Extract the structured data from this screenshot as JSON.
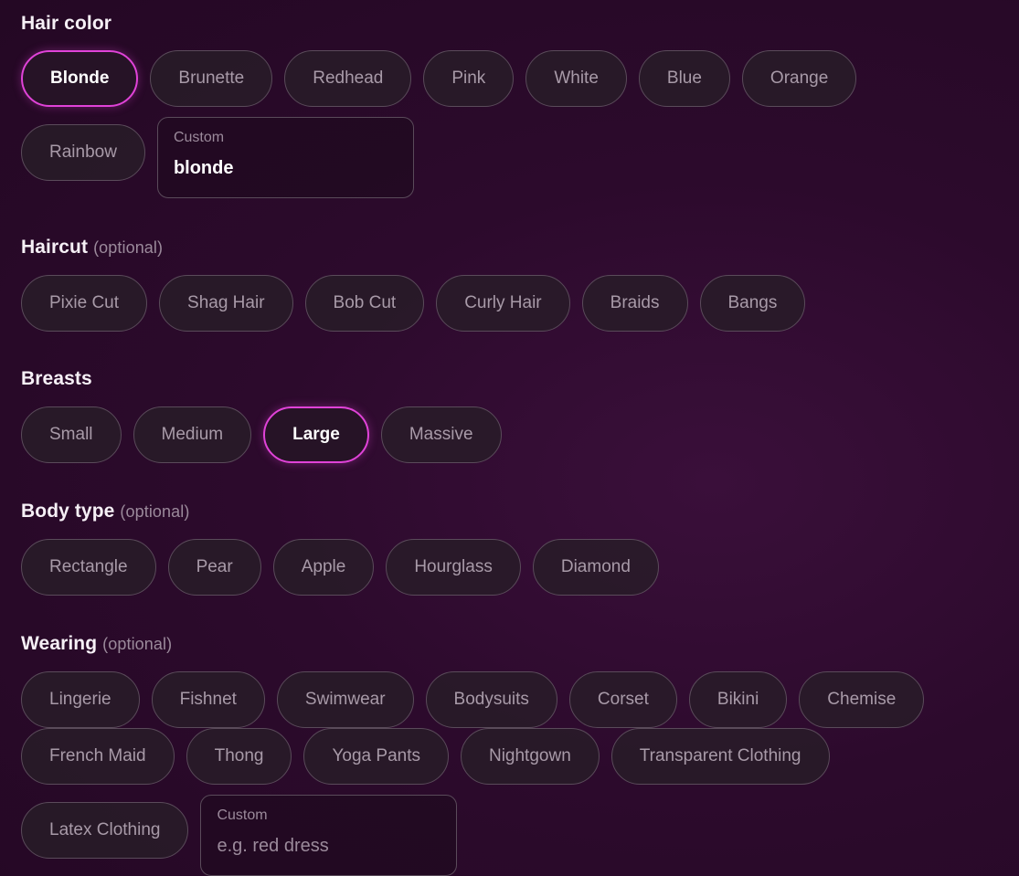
{
  "hair_color": {
    "title": "Hair color",
    "options": [
      "Blonde",
      "Brunette",
      "Redhead",
      "Pink",
      "White",
      "Blue",
      "Orange",
      "Rainbow"
    ],
    "selected": "Blonde",
    "custom_label": "Custom",
    "custom_value": "blonde",
    "custom_placeholder": ""
  },
  "haircut": {
    "title": "Haircut",
    "optional": "(optional)",
    "options": [
      "Pixie Cut",
      "Shag Hair",
      "Bob Cut",
      "Curly Hair",
      "Braids",
      "Bangs"
    ]
  },
  "breasts": {
    "title": "Breasts",
    "options": [
      "Small",
      "Medium",
      "Large",
      "Massive"
    ],
    "selected": "Large"
  },
  "body_type": {
    "title": "Body type",
    "optional": "(optional)",
    "options": [
      "Rectangle",
      "Pear",
      "Apple",
      "Hourglass",
      "Diamond"
    ]
  },
  "wearing": {
    "title": "Wearing",
    "optional": "(optional)",
    "options": [
      "Lingerie",
      "Fishnet",
      "Swimwear",
      "Bodysuits",
      "Corset",
      "Bikini",
      "Chemise",
      "French Maid",
      "Thong",
      "Yoga Pants",
      "Nightgown",
      "Transparent Clothing",
      "Latex Clothing"
    ],
    "custom_label": "Custom",
    "custom_value": "",
    "custom_placeholder": "e.g. red dress"
  },
  "colors": {
    "accent": "#e043d8",
    "chip_border": "#5a4b5a",
    "background": "#2c0a2c"
  }
}
